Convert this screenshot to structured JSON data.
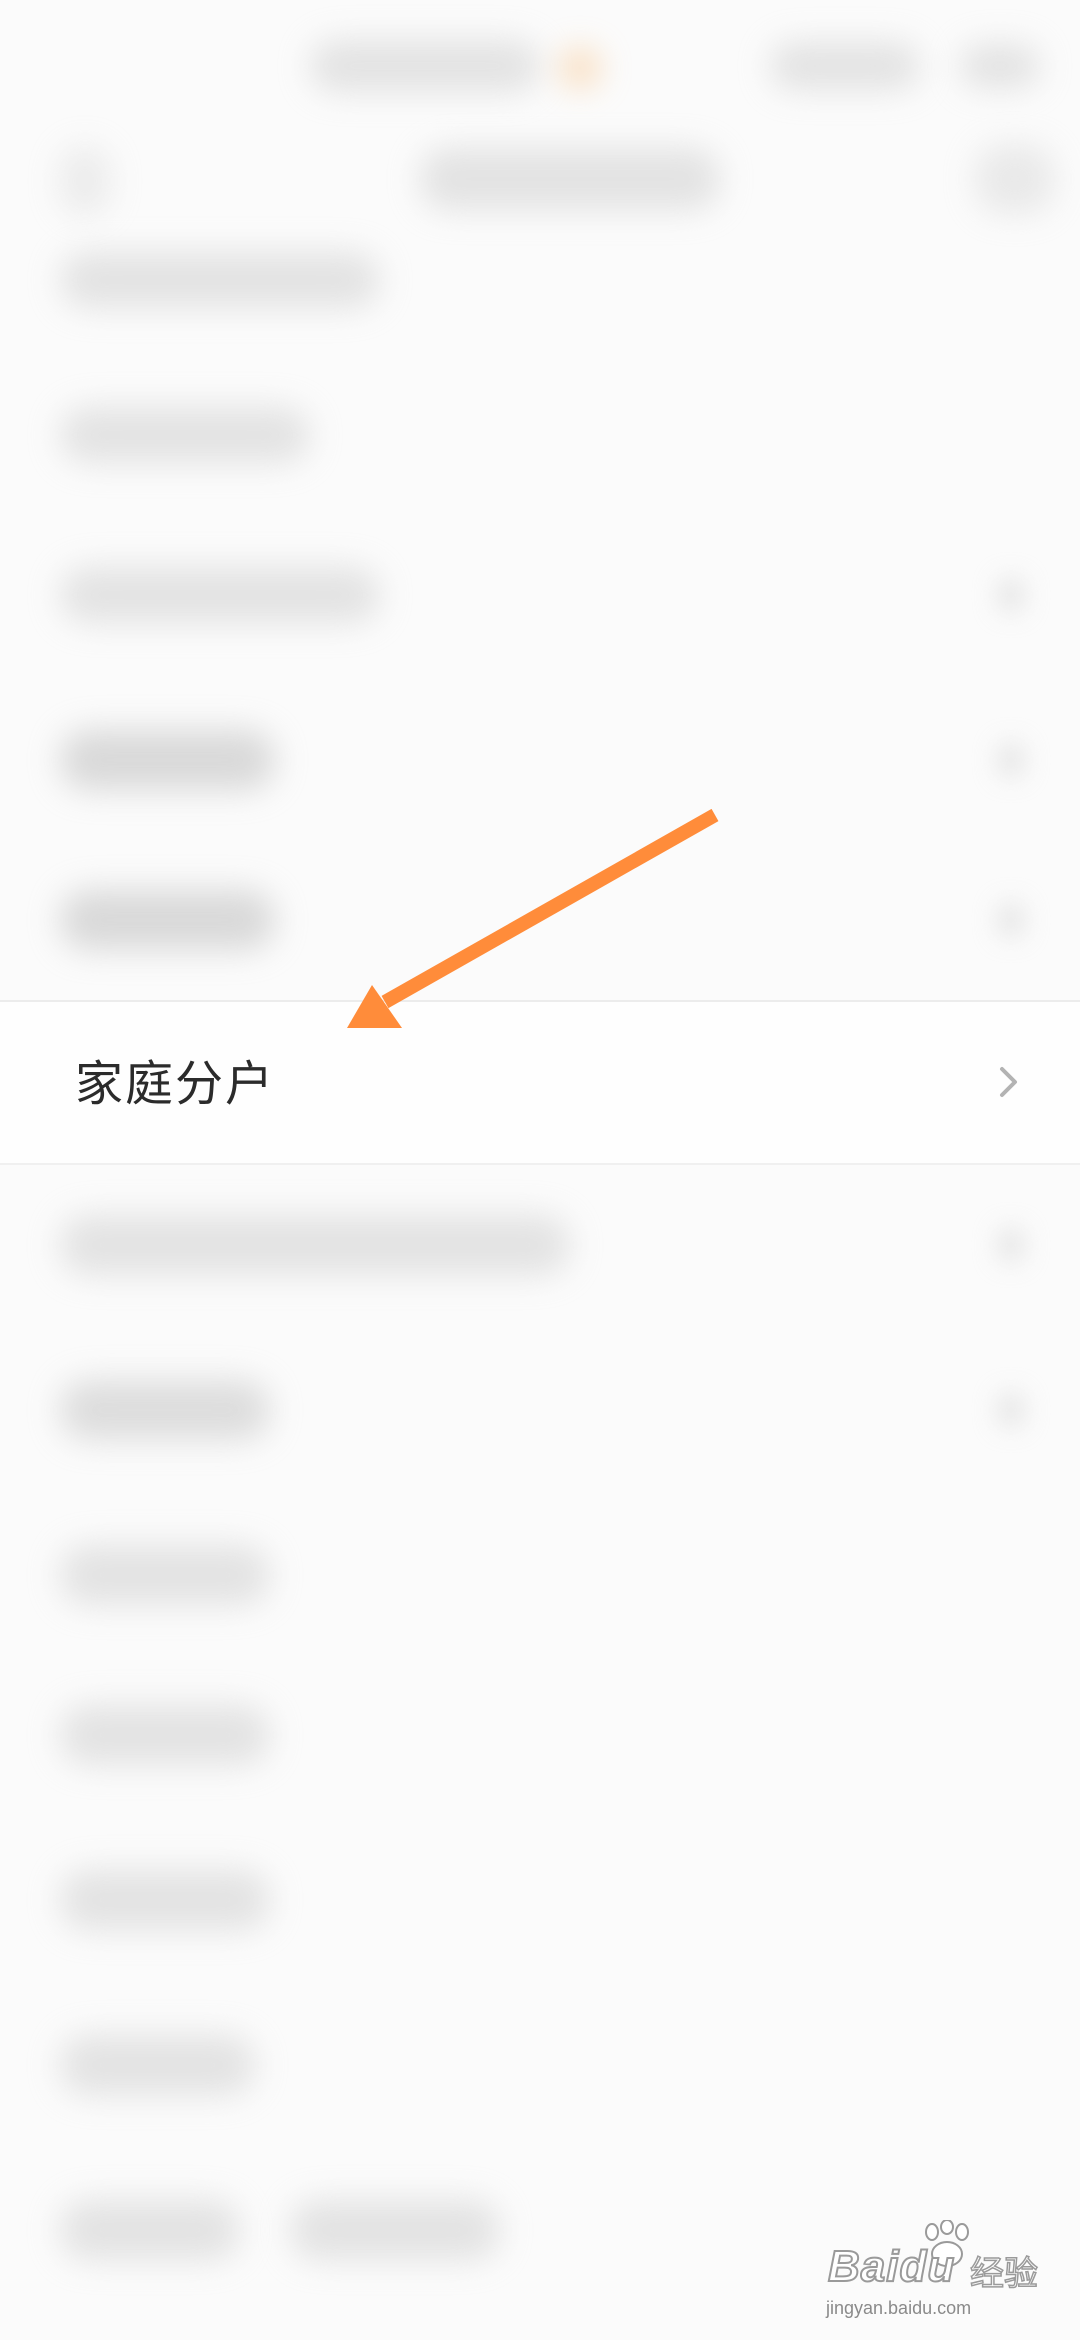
{
  "settings_list": {
    "focused_item": {
      "label": "家庭分户",
      "chevron_icon": "chevron-right-icon"
    }
  },
  "annotation": {
    "arrow_color": "#ff8c3a",
    "arrow_icon": "arrow-pointer-icon"
  },
  "watermark": {
    "brand": "Bai",
    "brand_suffix": "du",
    "cn_text": "经验",
    "url": "jingyan.baidu.com",
    "paw_icon": "baidu-paw-icon"
  }
}
